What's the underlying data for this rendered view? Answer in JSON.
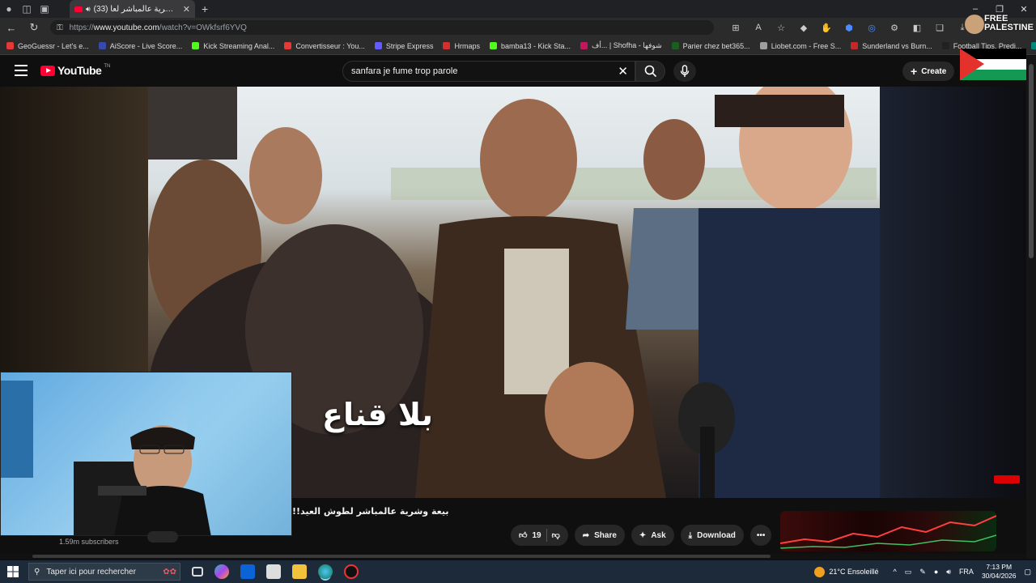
{
  "browser": {
    "tab_title": "(33) بيعة وشرية عالمباشر لعا...",
    "url_prefix": "https://",
    "url_domain": "www.youtube.com",
    "url_path": "/watch?v=OWkfsrf6YVQ",
    "bookmarks": [
      {
        "label": "GeoGuessr - Let's e...",
        "color": "#e53935"
      },
      {
        "label": "AiScore - Live Score...",
        "color": "#3949ab"
      },
      {
        "label": "Kick Streaming Anal...",
        "color": "#53fc18"
      },
      {
        "label": "Convertisseur : You...",
        "color": "#e53935"
      },
      {
        "label": "Stripe Express",
        "color": "#635bff"
      },
      {
        "label": "Hrmaps",
        "color": "#d32f2f"
      },
      {
        "label": "bamba13 - Kick Sta...",
        "color": "#53fc18"
      },
      {
        "label": "أف... | Shofha - شوفها",
        "color": "#c2185b"
      },
      {
        "label": "Parier chez bet365...",
        "color": "#1b5e20"
      },
      {
        "label": "Liobet.com - Free S...",
        "color": "#9e9e9e"
      },
      {
        "label": "Sunderland vs Burn...",
        "color": "#c62828"
      },
      {
        "label": "Football Tips, Predi...",
        "color": "#212121"
      },
      {
        "label": "Bet Th",
        "color": "#00897b"
      }
    ],
    "overlay_text_1": "FREE",
    "overlay_text_2": "PALESTINE"
  },
  "youtube": {
    "logo_text": "YouTube",
    "region": "TN",
    "search_value": "sanfara je fume trop parole",
    "create_label": "Create"
  },
  "video": {
    "caption": "بلا قناع",
    "title": "!!بيعة وشرية عالمباشر لطوش العيد",
    "subscribers": "1.59m subscribers",
    "likes": "19",
    "share_label": "Share",
    "ask_label": "Ask",
    "download_label": "Download"
  },
  "taskbar": {
    "search_placeholder": "Taper ici pour rechercher",
    "weather": "21°C  Ensoleillé",
    "language": "FRA",
    "time": "7:13 PM",
    "date": "30/04/2026"
  },
  "colors": {
    "accent": "#ff0033",
    "background": "#0f0f0f",
    "taskbar": "#1c2a3a"
  }
}
